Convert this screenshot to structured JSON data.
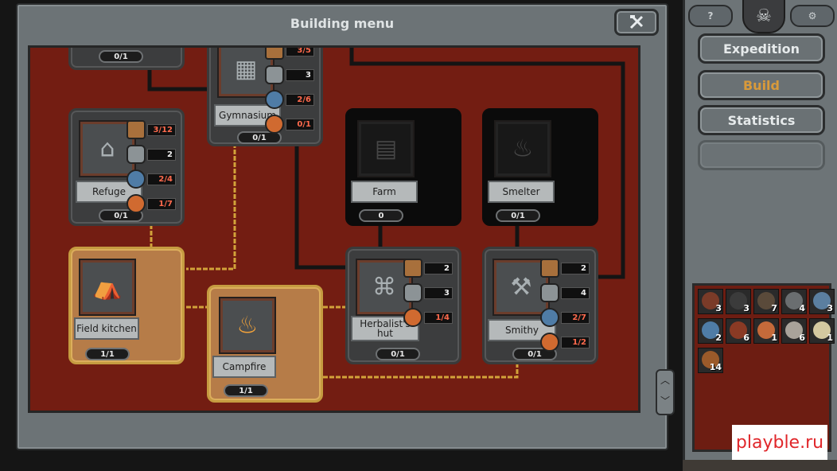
{
  "window": {
    "title": "Building menu",
    "close_icon": "hammer-cross-icon"
  },
  "buildings": {
    "top_stub": {
      "count": "0/1"
    },
    "gymnasium": {
      "label": "Gymnasium",
      "count": "0/1",
      "resources": [
        {
          "icon": "wood",
          "value": "3/5",
          "red": true
        },
        {
          "icon": "stone",
          "value": "3",
          "red": false
        },
        {
          "icon": "metal",
          "value": "2/6",
          "red": true
        },
        {
          "icon": "food",
          "value": "0/1",
          "red": true
        }
      ]
    },
    "refuge": {
      "label": "Refuge",
      "count": "0/1",
      "resources": [
        {
          "icon": "wood",
          "value": "3/12",
          "red": true
        },
        {
          "icon": "stone",
          "value": "2",
          "red": false
        },
        {
          "icon": "metal",
          "value": "2/4",
          "red": true
        },
        {
          "icon": "food",
          "value": "1/7",
          "red": true
        }
      ]
    },
    "farm": {
      "label": "Farm",
      "count": "0"
    },
    "smelter": {
      "label": "Smelter",
      "count": "0/1"
    },
    "field_kitchen": {
      "label": "Field kitchen",
      "count": "1/1"
    },
    "campfire": {
      "label": "Campfire",
      "count": "1/1"
    },
    "herbalists_hut": {
      "label": "Herbalist's hut",
      "count": "0/1",
      "resources": [
        {
          "icon": "wood",
          "value": "2",
          "red": false
        },
        {
          "icon": "stone",
          "value": "3",
          "red": false
        },
        {
          "icon": "food",
          "value": "1/4",
          "red": true
        }
      ]
    },
    "smithy": {
      "label": "Smithy",
      "count": "0/1",
      "resources": [
        {
          "icon": "wood",
          "value": "2",
          "red": false
        },
        {
          "icon": "stone",
          "value": "4",
          "red": false
        },
        {
          "icon": "metal",
          "value": "2/7",
          "red": true
        },
        {
          "icon": "food",
          "value": "1/2",
          "red": true
        }
      ]
    }
  },
  "sidebar": {
    "help_label": "?",
    "settings_icon": "gears-icon",
    "nav": [
      {
        "label": "Expedition",
        "active": false
      },
      {
        "label": "Build",
        "active": true
      },
      {
        "label": "Statistics",
        "active": false
      }
    ]
  },
  "inventory": [
    {
      "icon": "bow",
      "qty": "3",
      "color": "#7a3b28"
    },
    {
      "icon": "plank",
      "qty": "3",
      "color": "#3b3b3b"
    },
    {
      "icon": "branch",
      "qty": "7",
      "color": "#5a4a3a"
    },
    {
      "icon": "rock",
      "qty": "4",
      "color": "#6a6e70"
    },
    {
      "icon": "orb",
      "qty": "3",
      "color": "#5b7fa0"
    },
    {
      "icon": "metal-orb",
      "qty": "2",
      "color": "#4f7ca6"
    },
    {
      "icon": "root",
      "qty": "6",
      "color": "#8a3a24"
    },
    {
      "icon": "mushroom",
      "qty": "1",
      "color": "#c46a3a"
    },
    {
      "icon": "bundle",
      "qty": "6",
      "color": "#a9a39a"
    },
    {
      "icon": "book",
      "qty": "1",
      "color": "#d4c9a0"
    },
    {
      "icon": "food-ring",
      "qty": "14",
      "color": "#9b5a2a"
    }
  ],
  "watermark": "playble.ru"
}
